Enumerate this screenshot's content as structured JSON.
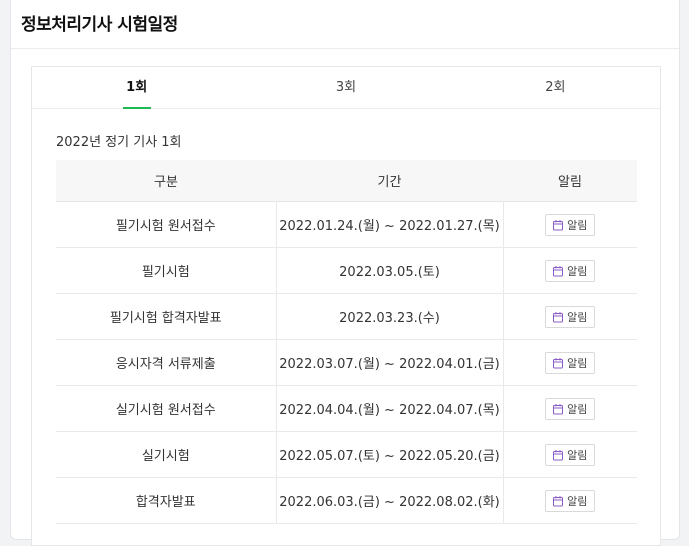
{
  "page": {
    "title": "정보처리기사 시험일정"
  },
  "tabs": [
    {
      "label": "1회",
      "active": true
    },
    {
      "label": "3회",
      "active": false
    },
    {
      "label": "2회",
      "active": false
    }
  ],
  "schedule": {
    "subtitle": "2022년 정기 기사 1회",
    "headers": {
      "category": "구분",
      "period": "기간",
      "alarm": "알림"
    },
    "rows": [
      {
        "category": "필기시험 원서접수",
        "period": "2022.01.24.(월) ~ 2022.01.27.(목)",
        "alarm_label": "알림"
      },
      {
        "category": "필기시험",
        "period": "2022.03.05.(토)",
        "alarm_label": "알림"
      },
      {
        "category": "필기시험 합격자발표",
        "period": "2022.03.23.(수)",
        "alarm_label": "알림"
      },
      {
        "category": "응시자격 서류제출",
        "period": "2022.03.07.(월) ~ 2022.04.01.(금)",
        "alarm_label": "알림"
      },
      {
        "category": "실기시험 원서접수",
        "period": "2022.04.04.(월) ~ 2022.04.07.(목)",
        "alarm_label": "알림"
      },
      {
        "category": "실기시험",
        "period": "2022.05.07.(토) ~ 2022.05.20.(금)",
        "alarm_label": "알림"
      },
      {
        "category": "합격자발표",
        "period": "2022.06.03.(금) ~ 2022.08.02.(화)",
        "alarm_label": "알림"
      }
    ]
  },
  "icons": {
    "alarm": "calendar-icon"
  },
  "colors": {
    "active_tab_underline": "#1db954",
    "calendar_icon": "#8a5cc7"
  }
}
